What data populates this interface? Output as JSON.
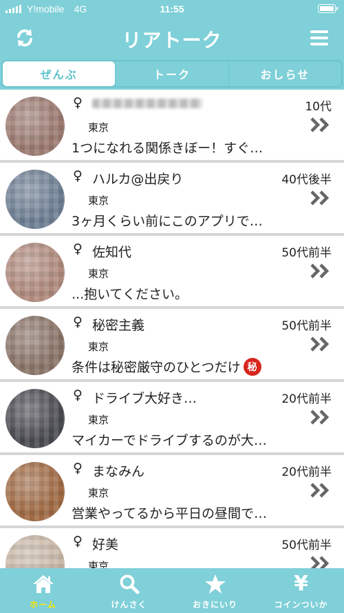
{
  "status_bar": {
    "carrier": "Y!mobile",
    "network": "4G",
    "time": "11:55"
  },
  "header": {
    "title": "リアトーク",
    "refresh_icon": "refresh-icon",
    "menu_icon": "menu-icon"
  },
  "tabs": [
    {
      "label": "ぜんぶ",
      "active": true
    },
    {
      "label": "トーク",
      "active": false
    },
    {
      "label": "おしらせ",
      "active": false
    }
  ],
  "users": [
    {
      "gender": "♀",
      "name": "",
      "age": "10代",
      "area": "東京",
      "message": "1つになれる関係きぼー！すぐ…",
      "secret_badge": "",
      "avatar_color": "#9b7a70"
    },
    {
      "gender": "♀",
      "name": "ハルカ@出戻り",
      "age": "40代後半",
      "area": "東京",
      "message": "3ヶ月くらい前にこのアプリで…",
      "secret_badge": "",
      "avatar_color": "#6e7f94"
    },
    {
      "gender": "♀",
      "name": "佐知代",
      "age": "50代前半",
      "area": "東京",
      "message": "...抱いてください。",
      "secret_badge": "",
      "avatar_color": "#b08a7d"
    },
    {
      "gender": "♀",
      "name": "秘密主義",
      "age": "50代前半",
      "area": "東京",
      "message": "条件は秘密厳守のひとつだけ",
      "secret_badge": "秘",
      "avatar_color": "#8a7468"
    },
    {
      "gender": "♀",
      "name": "ドライブ大好き…",
      "age": "20代前半",
      "area": "東京",
      "message": "マイカーでドライブするのが大…",
      "secret_badge": "",
      "avatar_color": "#4a4a52"
    },
    {
      "gender": "♀",
      "name": "まなみん",
      "age": "20代前半",
      "area": "東京",
      "message": "営業やってるから平日の昼間で…",
      "secret_badge": "",
      "avatar_color": "#a06a44"
    },
    {
      "gender": "♀",
      "name": "好美",
      "age": "50代前半",
      "area": "東京",
      "message": "",
      "secret_badge": "",
      "avatar_color": "#c9b8a8"
    }
  ],
  "bottom_nav": [
    {
      "label": "ホーム",
      "icon": "home-icon",
      "active": true
    },
    {
      "label": "けんさく",
      "icon": "search-icon",
      "active": false
    },
    {
      "label": "おきにいり",
      "icon": "star-icon",
      "active": false
    },
    {
      "label": "コインついか",
      "icon": "yen-icon",
      "active": false
    }
  ],
  "colors": {
    "accent": "#7fd0d8",
    "active_nav": "#ffe500",
    "secret_badge": "#d7261e"
  }
}
